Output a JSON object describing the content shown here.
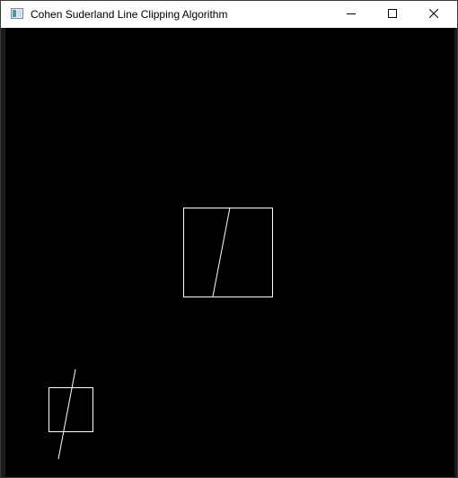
{
  "window": {
    "title": "Cohen Suderland Line Clipping Algorithm",
    "icon": "app-window-icon",
    "controls": {
      "minimize_icon": "minimize-icon",
      "maximize_icon": "maximize-icon",
      "close_icon": "close-icon"
    }
  },
  "canvas": {
    "background": "#000000",
    "stroke_color": "#ffffff"
  }
}
